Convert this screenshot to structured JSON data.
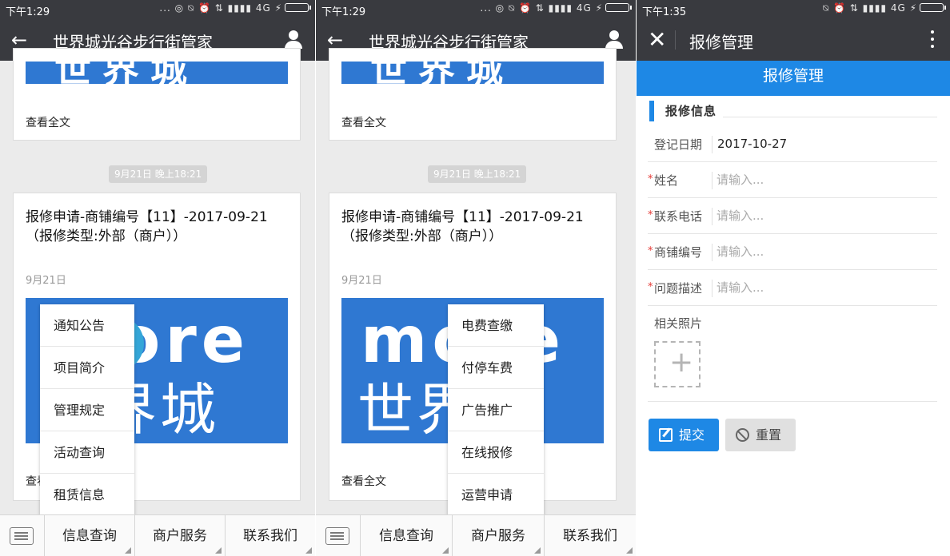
{
  "screens": [
    {
      "status": {
        "time": "下午1:29",
        "icons": "... ◎ ⍉ ⏰ ⇅ ▮▮▮▮ 4G ⚡"
      },
      "header": {
        "title": "世界城光谷步行街管家"
      },
      "chat": {
        "read_all_top": "查看全文",
        "timestamp": "9月21日 晚上18:21",
        "article": {
          "title": "报修申请-商铺编号【11】-2017-09-21（报修类型:外部（商户））",
          "date": "9月21日",
          "banner_text_top": "more",
          "banner_text_bottom": "世界城",
          "read_all": "查看全文"
        }
      },
      "popup": [
        "通知公告",
        "项目简介",
        "管理规定",
        "活动查询",
        "租赁信息"
      ],
      "menu": [
        "信息查询",
        "商户服务",
        "联系我们"
      ]
    },
    {
      "status": {
        "time": "下午1:29",
        "icons": "... ◎ ⍉ ⏰ ⇅ ▮▮▮▮ 4G ⚡"
      },
      "header": {
        "title": "世界城光谷步行街管家"
      },
      "chat": {
        "read_all_top": "查看全文",
        "timestamp": "9月21日 晚上18:21",
        "article": {
          "title": "报修申请-商铺编号【11】-2017-09-21（报修类型:外部（商户））",
          "date": "9月21日",
          "banner_text_top": "more",
          "banner_text_bottom": "世界城",
          "read_all": "查看全文"
        }
      },
      "popup": [
        "电费查缴",
        "付停车费",
        "广告推广",
        "在线报修",
        "运营申请"
      ],
      "menu": [
        "信息查询",
        "商户服务",
        "联系我们"
      ]
    }
  ],
  "form_screen": {
    "status": {
      "time": "下午1:35",
      "icons": "⍉ ⏰ ⇅ ▮▮▮▮ 4G ⚡"
    },
    "header": {
      "title": "报修管理"
    },
    "banner": "报修管理",
    "section_title": "报修信息",
    "date_row": {
      "label": "登记日期",
      "value": "2017-10-27"
    },
    "fields": [
      {
        "label": "姓名",
        "placeholder": "请输入..."
      },
      {
        "label": "联系电话",
        "placeholder": "请输入..."
      },
      {
        "label": "商铺编号",
        "placeholder": "请输入..."
      },
      {
        "label": "问题描述",
        "placeholder": "请输入..."
      }
    ],
    "required_mark": "*",
    "photos_label": "相关照片",
    "add_symbol": "+",
    "submit_label": "提交",
    "reset_label": "重置"
  },
  "colors": {
    "dark_bar": "#393a3f",
    "chat_bg": "#ebebeb",
    "brand_blue": "#1e88e5",
    "banner_blue": "#2f78d2",
    "required_red": "#e53935"
  }
}
